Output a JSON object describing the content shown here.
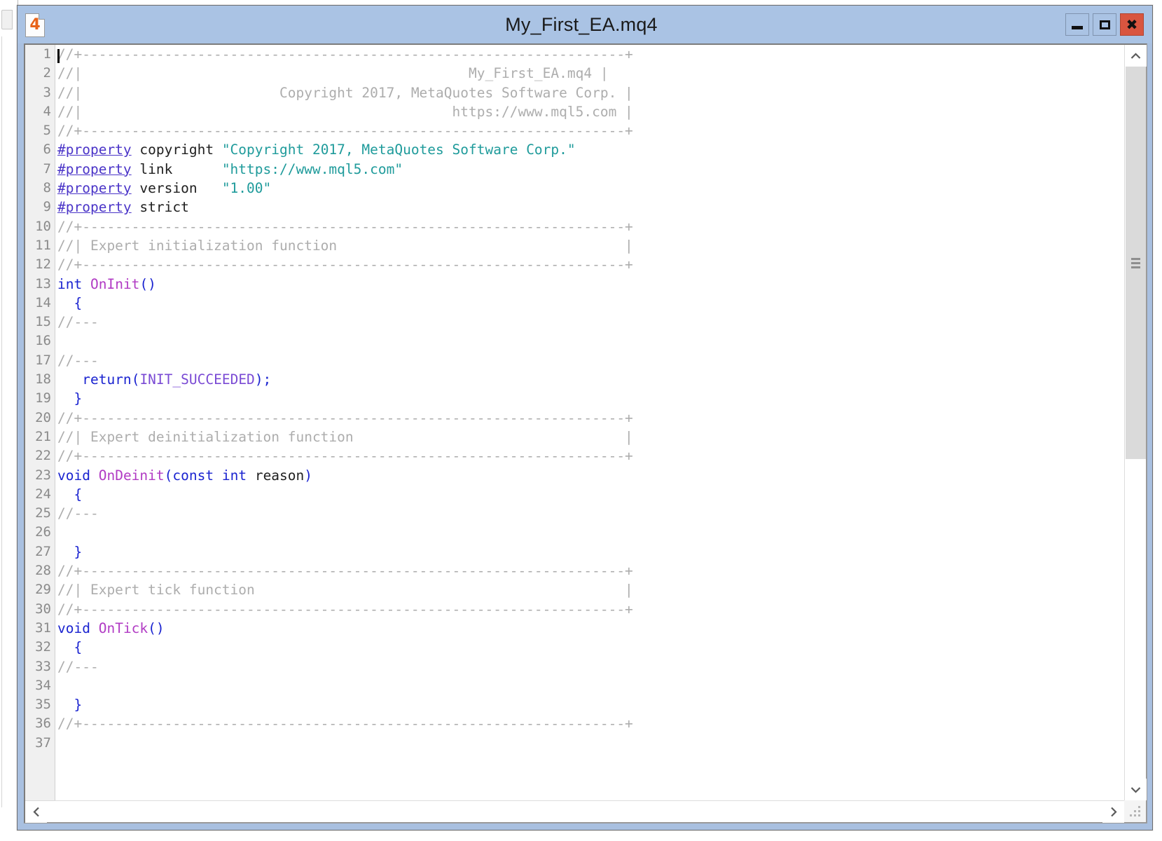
{
  "window": {
    "title": "My_First_EA.mq4",
    "icon_label": "4",
    "controls": {
      "minimize_label": "—",
      "maximize_label": "□",
      "close_label": "✖"
    }
  },
  "scrollbars": {
    "vertical": {
      "up_label": "⌃",
      "down_label": "⌄"
    },
    "horizontal": {
      "left_label": "‹",
      "right_label": "›"
    }
  },
  "editor": {
    "line_count": 37,
    "line_numbers": [
      "1",
      "2",
      "3",
      "4",
      "5",
      "6",
      "7",
      "8",
      "9",
      "10",
      "11",
      "12",
      "13",
      "14",
      "15",
      "16",
      "17",
      "18",
      "19",
      "20",
      "21",
      "22",
      "23",
      "24",
      "25",
      "26",
      "27",
      "28",
      "29",
      "30",
      "31",
      "32",
      "33",
      "34",
      "35",
      "36",
      "37"
    ],
    "lines": [
      {
        "n": "1",
        "tokens": [
          {
            "t": "//+------------------------------------------------------------------+",
            "c": "com"
          }
        ]
      },
      {
        "n": "2",
        "tokens": [
          {
            "t": "//|                                               My_First_EA.mq4 |",
            "c": "com"
          }
        ]
      },
      {
        "n": "3",
        "tokens": [
          {
            "t": "//|                        Copyright 2017, MetaQuotes Software Corp. |",
            "c": "com"
          }
        ]
      },
      {
        "n": "4",
        "tokens": [
          {
            "t": "//|                                             https://www.mql5.com |",
            "c": "com"
          }
        ]
      },
      {
        "n": "5",
        "tokens": [
          {
            "t": "//+------------------------------------------------------------------+",
            "c": "com"
          }
        ]
      },
      {
        "n": "6",
        "tokens": [
          {
            "t": "#property",
            "c": "prop"
          },
          {
            "t": " copyright ",
            "c": "plain"
          },
          {
            "t": "\"Copyright 2017, MetaQuotes Software Corp.\"",
            "c": "str"
          }
        ]
      },
      {
        "n": "7",
        "tokens": [
          {
            "t": "#property",
            "c": "prop"
          },
          {
            "t": " link      ",
            "c": "plain"
          },
          {
            "t": "\"https://www.mql5.com\"",
            "c": "str"
          }
        ]
      },
      {
        "n": "8",
        "tokens": [
          {
            "t": "#property",
            "c": "prop"
          },
          {
            "t": " version   ",
            "c": "plain"
          },
          {
            "t": "\"1.00\"",
            "c": "str"
          }
        ]
      },
      {
        "n": "9",
        "tokens": [
          {
            "t": "#property",
            "c": "prop"
          },
          {
            "t": " strict",
            "c": "plain"
          }
        ]
      },
      {
        "n": "10",
        "tokens": [
          {
            "t": "//+------------------------------------------------------------------+",
            "c": "com"
          }
        ]
      },
      {
        "n": "11",
        "tokens": [
          {
            "t": "//| Expert initialization function                                   |",
            "c": "com"
          }
        ]
      },
      {
        "n": "12",
        "tokens": [
          {
            "t": "//+------------------------------------------------------------------+",
            "c": "com"
          }
        ]
      },
      {
        "n": "13",
        "tokens": [
          {
            "t": "int",
            "c": "kw"
          },
          {
            "t": " ",
            "c": "plain"
          },
          {
            "t": "OnInit",
            "c": "fn"
          },
          {
            "t": "()",
            "c": "punct"
          }
        ]
      },
      {
        "n": "14",
        "tokens": [
          {
            "t": "  ",
            "c": "plain"
          },
          {
            "t": "{",
            "c": "punct"
          }
        ]
      },
      {
        "n": "15",
        "tokens": [
          {
            "t": "//---",
            "c": "com"
          }
        ]
      },
      {
        "n": "16",
        "tokens": [
          {
            "t": "",
            "c": "plain"
          }
        ]
      },
      {
        "n": "17",
        "tokens": [
          {
            "t": "//---",
            "c": "com"
          }
        ]
      },
      {
        "n": "18",
        "tokens": [
          {
            "t": "   ",
            "c": "plain"
          },
          {
            "t": "return",
            "c": "kw"
          },
          {
            "t": "(",
            "c": "punct"
          },
          {
            "t": "INIT_SUCCEEDED",
            "c": "const"
          },
          {
            "t": ");",
            "c": "punct"
          }
        ]
      },
      {
        "n": "19",
        "tokens": [
          {
            "t": "  ",
            "c": "plain"
          },
          {
            "t": "}",
            "c": "punct"
          }
        ]
      },
      {
        "n": "20",
        "tokens": [
          {
            "t": "//+------------------------------------------------------------------+",
            "c": "com"
          }
        ]
      },
      {
        "n": "21",
        "tokens": [
          {
            "t": "//| Expert deinitialization function                                 |",
            "c": "com"
          }
        ]
      },
      {
        "n": "22",
        "tokens": [
          {
            "t": "//+------------------------------------------------------------------+",
            "c": "com"
          }
        ]
      },
      {
        "n": "23",
        "tokens": [
          {
            "t": "void",
            "c": "kw"
          },
          {
            "t": " ",
            "c": "plain"
          },
          {
            "t": "OnDeinit",
            "c": "fn"
          },
          {
            "t": "(",
            "c": "punct"
          },
          {
            "t": "const",
            "c": "kw"
          },
          {
            "t": " ",
            "c": "plain"
          },
          {
            "t": "int",
            "c": "kw"
          },
          {
            "t": " ",
            "c": "plain"
          },
          {
            "t": "reason",
            "c": "plain"
          },
          {
            "t": ")",
            "c": "punct"
          }
        ]
      },
      {
        "n": "24",
        "tokens": [
          {
            "t": "  ",
            "c": "plain"
          },
          {
            "t": "{",
            "c": "punct"
          }
        ]
      },
      {
        "n": "25",
        "tokens": [
          {
            "t": "//---",
            "c": "com"
          }
        ]
      },
      {
        "n": "26",
        "tokens": [
          {
            "t": "",
            "c": "plain"
          }
        ]
      },
      {
        "n": "27",
        "tokens": [
          {
            "t": "  ",
            "c": "plain"
          },
          {
            "t": "}",
            "c": "punct"
          }
        ]
      },
      {
        "n": "28",
        "tokens": [
          {
            "t": "//+------------------------------------------------------------------+",
            "c": "com"
          }
        ]
      },
      {
        "n": "29",
        "tokens": [
          {
            "t": "//| Expert tick function                                             |",
            "c": "com"
          }
        ]
      },
      {
        "n": "30",
        "tokens": [
          {
            "t": "//+------------------------------------------------------------------+",
            "c": "com"
          }
        ]
      },
      {
        "n": "31",
        "tokens": [
          {
            "t": "void",
            "c": "kw"
          },
          {
            "t": " ",
            "c": "plain"
          },
          {
            "t": "OnTick",
            "c": "fn"
          },
          {
            "t": "()",
            "c": "punct"
          }
        ]
      },
      {
        "n": "32",
        "tokens": [
          {
            "t": "  ",
            "c": "plain"
          },
          {
            "t": "{",
            "c": "punct"
          }
        ]
      },
      {
        "n": "33",
        "tokens": [
          {
            "t": "//---",
            "c": "com"
          }
        ]
      },
      {
        "n": "34",
        "tokens": [
          {
            "t": "",
            "c": "plain"
          }
        ]
      },
      {
        "n": "35",
        "tokens": [
          {
            "t": "  ",
            "c": "plain"
          },
          {
            "t": "}",
            "c": "punct"
          }
        ]
      },
      {
        "n": "36",
        "tokens": [
          {
            "t": "//+------------------------------------------------------------------+",
            "c": "com"
          }
        ]
      },
      {
        "n": "37",
        "tokens": [
          {
            "t": "",
            "c": "plain"
          }
        ]
      }
    ]
  },
  "colors": {
    "title_bar": "#aac3e4",
    "close_button": "#d9553f",
    "comment": "#adadad",
    "keyword": "#1a23d0",
    "property": "#4b35c8",
    "function": "#b13bc4",
    "string": "#1f9b9b",
    "constant": "#7a4ad4",
    "gutter": "#f0f0f0"
  }
}
